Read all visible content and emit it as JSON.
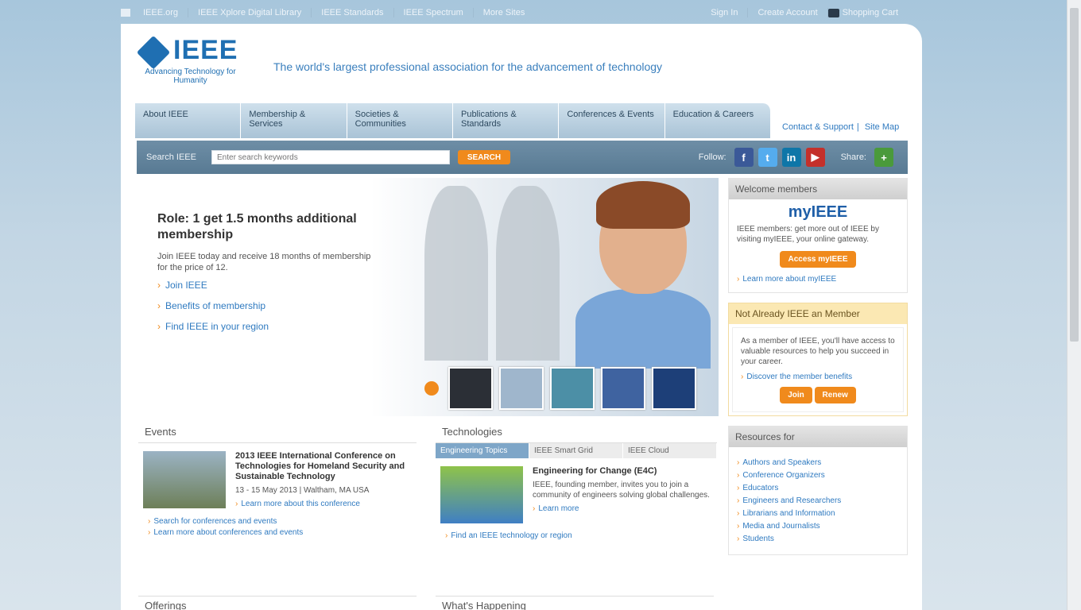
{
  "util": {
    "left_links": [
      "IEEE.org",
      "IEEE Xplore Digital Library",
      "IEEE Standards",
      "IEEE Spectrum",
      "More Sites"
    ],
    "right_links": [
      "Sign In",
      "Create Account",
      "Shopping Cart"
    ]
  },
  "logo": {
    "word": "IEEE",
    "tagline": "Advancing Technology for Humanity"
  },
  "header": {
    "tagline": "The world's largest professional association for the advancement of technology"
  },
  "nav": {
    "tabs": [
      "About IEEE",
      "Membership & Services",
      "Societies & Communities",
      "Publications & Standards",
      "Conferences & Events",
      "Education & Careers"
    ],
    "links": [
      "Contact & Support",
      "Site Map"
    ]
  },
  "search": {
    "label": "Search IEEE",
    "placeholder": "Enter search keywords",
    "button": "SEARCH",
    "follow_label": "Follow:",
    "share_label": "Share:"
  },
  "hero": {
    "title": "Role: 1 get 1.5 months additional membership",
    "text": "Join IEEE today and receive 18 months of membership for the price of 12.",
    "links": [
      "Join IEEE",
      "Benefits of membership",
      "Find IEEE in your region"
    ]
  },
  "side": {
    "welcome_header": "Welcome members",
    "welcome_logo": "myIEEE",
    "welcome_text": "IEEE members: get more out of IEEE by visiting myIEEE, your online gateway.",
    "welcome_button": "Access myIEEE",
    "welcome_link": "Learn more about myIEEE",
    "join_header": "Not Already IEEE an Member",
    "join_text": "As a member of IEEE, you'll have access to valuable resources to help you succeed in your career.",
    "join_link": "Discover the member benefits",
    "join_btn1": "Join",
    "join_btn2": "Renew",
    "resources_header": "Resources for",
    "resources": [
      "Authors and Speakers",
      "Conference Organizers",
      "Educators",
      "Engineers and Researchers",
      "Librarians and Information",
      "Media and Journalists",
      "Students"
    ]
  },
  "events": {
    "title": "Events",
    "item_title": "2013 IEEE International Conference on Technologies for Homeland Security and Sustainable Technology",
    "item_text": "13 - 15 May 2013 | Waltham, MA USA",
    "item_link": "Learn more about this conference",
    "links": [
      "Search for conferences and events",
      "Learn more about conferences and events"
    ]
  },
  "tech": {
    "title": "Technologies",
    "subtabs": [
      "Engineering Topics",
      "IEEE Smart Grid",
      "IEEE Cloud"
    ],
    "item_title": "Engineering for Change (E4C)",
    "item_text": "IEEE, founding member, invites you to join a community of engineers solving global challenges.",
    "item_link": "Learn more",
    "link": "Find an IEEE technology or region"
  },
  "bottom": {
    "left_title": "Offerings",
    "right_title": "What's Happening"
  }
}
